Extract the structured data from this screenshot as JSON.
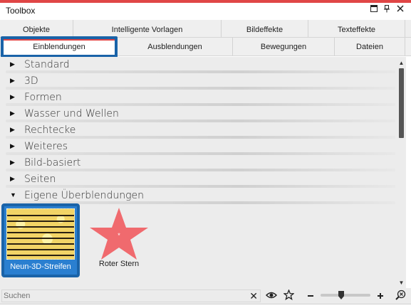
{
  "window": {
    "title": "Toolbox",
    "controls": [
      "menu",
      "pin",
      "close"
    ]
  },
  "tabs": {
    "row1": [
      {
        "label": "Objekte"
      },
      {
        "label": "Intelligente Vorlagen"
      },
      {
        "label": "Bildeffekte"
      },
      {
        "label": "Texteffekte"
      }
    ],
    "row2": [
      {
        "label": "Einblendungen",
        "active": true
      },
      {
        "label": "Ausblendungen"
      },
      {
        "label": "Bewegungen"
      },
      {
        "label": "Dateien"
      }
    ]
  },
  "tree": {
    "categories": [
      {
        "label": "Standard",
        "expanded": false
      },
      {
        "label": "3D",
        "expanded": false
      },
      {
        "label": "Formen",
        "expanded": false
      },
      {
        "label": "Wasser und Wellen",
        "expanded": false
      },
      {
        "label": "Rechtecke",
        "expanded": false
      },
      {
        "label": "Weiteres",
        "expanded": false
      },
      {
        "label": "Bild-basiert",
        "expanded": false
      },
      {
        "label": "Seiten",
        "expanded": false
      },
      {
        "label": "Eigene Überblendungen",
        "expanded": true
      }
    ],
    "items": [
      {
        "label": "Neun-3D-Streifen",
        "selected": true,
        "icon": "yellow-stripes-thumbnail"
      },
      {
        "label": "Roter Stern",
        "selected": false,
        "icon": "red-star-thumbnail"
      }
    ]
  },
  "bottom": {
    "search_placeholder": "Suchen",
    "search_value": "",
    "zoom_level": 0.4
  },
  "colors": {
    "accent": "#e04646",
    "selection": "#1a63a8",
    "star": "#f06a6e"
  }
}
